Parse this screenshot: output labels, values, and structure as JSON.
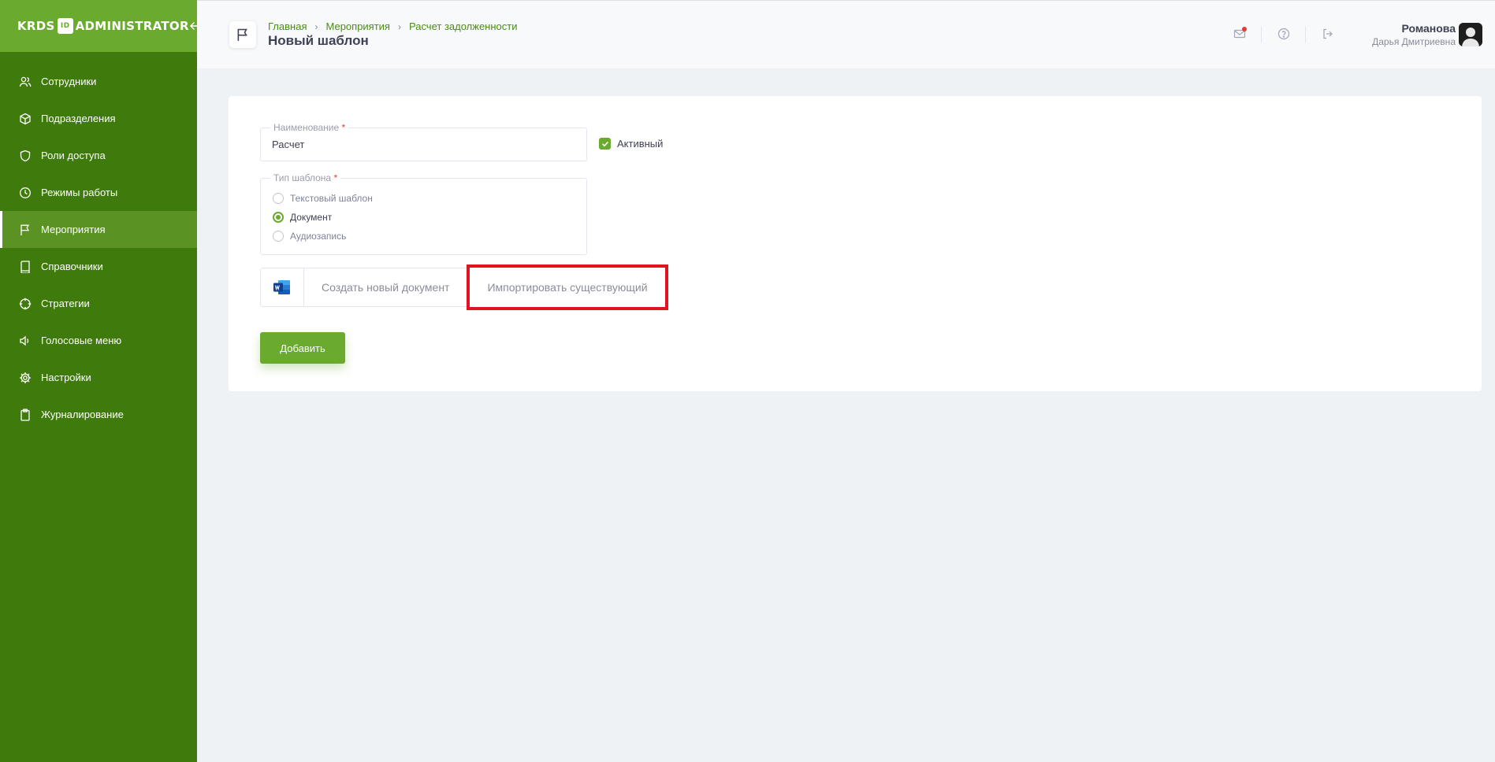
{
  "brand": {
    "left": "KRDS",
    "middle": "ID",
    "right": "ADMINISTRATOR"
  },
  "sidebar": {
    "items": [
      {
        "label": "Сотрудники",
        "icon": "users-icon",
        "active": false
      },
      {
        "label": "Подразделения",
        "icon": "cube-icon",
        "active": false
      },
      {
        "label": "Роли доступа",
        "icon": "shield-icon",
        "active": false
      },
      {
        "label": "Режимы работы",
        "icon": "clock-icon",
        "active": false
      },
      {
        "label": "Мероприятия",
        "icon": "flag-icon",
        "active": true
      },
      {
        "label": "Справочники",
        "icon": "book-icon",
        "active": false
      },
      {
        "label": "Стратегии",
        "icon": "crosshair-icon",
        "active": false
      },
      {
        "label": "Голосовые меню",
        "icon": "speaker-icon",
        "active": false
      },
      {
        "label": "Настройки",
        "icon": "gear-icon",
        "active": false
      },
      {
        "label": "Журналирование",
        "icon": "clipboard-icon",
        "active": false
      }
    ]
  },
  "header": {
    "breadcrumb": [
      "Главная",
      "Мероприятия",
      "Расчет задолженности"
    ],
    "title": "Новый шаблон",
    "user": {
      "last_name": "Романова",
      "first_name": "Дарья Дмитриевна"
    }
  },
  "form": {
    "name_legend": "Наименование",
    "name_value": "Расчет",
    "active_label": "Активный",
    "active_checked": true,
    "type_legend": "Тип шаблона",
    "required_mark": "*",
    "types": [
      {
        "label": "Текстовый шаблон",
        "checked": false
      },
      {
        "label": "Документ",
        "checked": true
      },
      {
        "label": "Аудиозапись",
        "checked": false
      }
    ],
    "create_doc_label": "Создать новый документ",
    "import_doc_label": "Импортировать существующий",
    "submit_label": "Добавить"
  },
  "colors": {
    "sidebar": "#3f7a0c",
    "accent": "#6aaa2e",
    "highlight": "#e0141e"
  }
}
